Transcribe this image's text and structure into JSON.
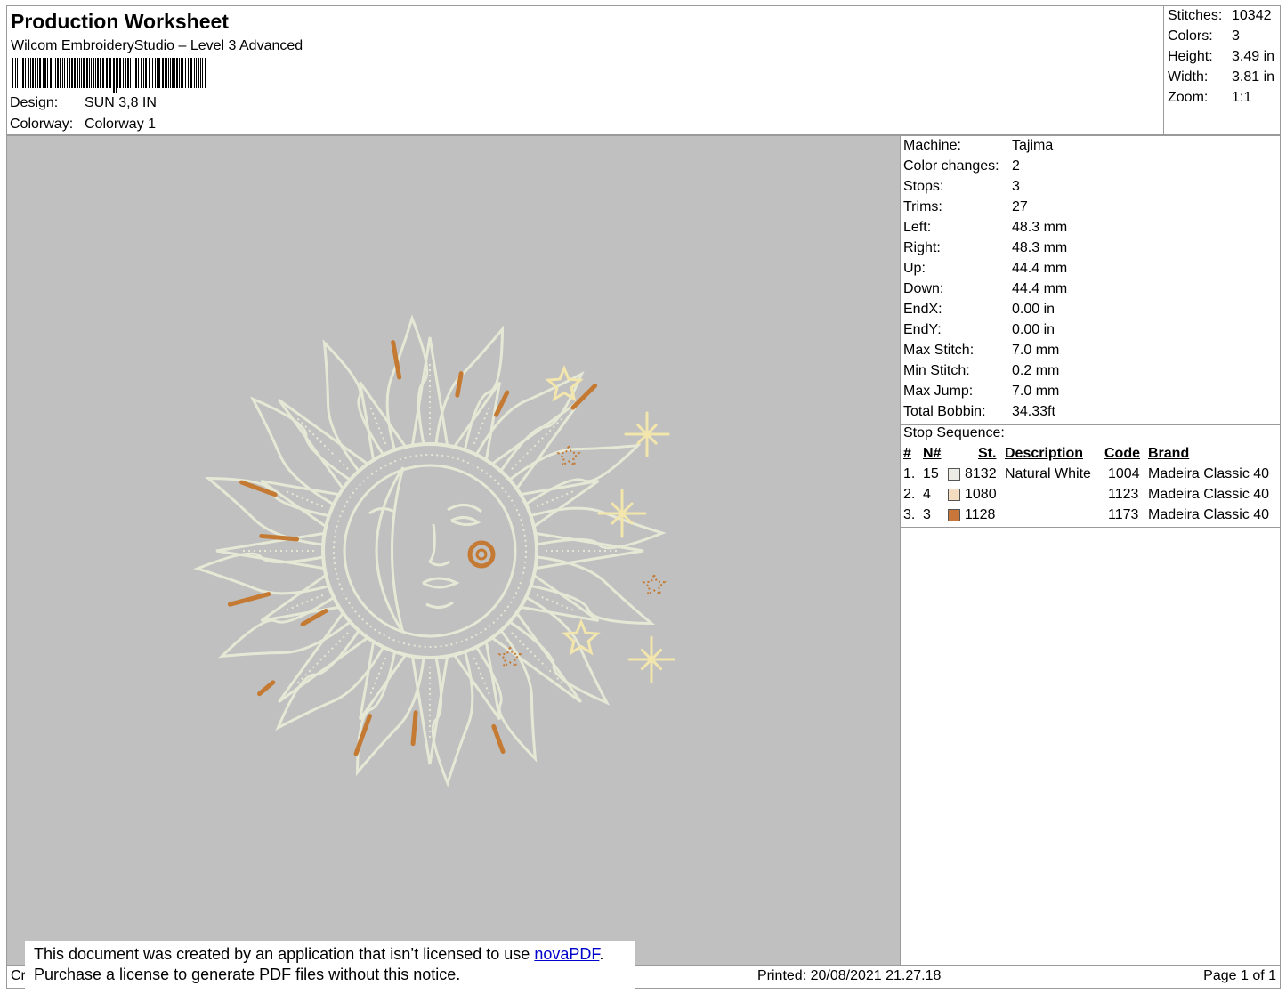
{
  "header": {
    "title": "Production Worksheet",
    "subtitle": "Wilcom EmbroideryStudio – Level 3 Advanced",
    "design_label": "Design:",
    "design_value": "SUN 3,8 IN",
    "colorway_label": "Colorway:",
    "colorway_value": "Colorway 1"
  },
  "summary": [
    {
      "label": "Stitches:",
      "value": "10342"
    },
    {
      "label": "Colors:",
      "value": "3"
    },
    {
      "label": "Height:",
      "value": "3.49 in"
    },
    {
      "label": "Width:",
      "value": "3.81 in"
    },
    {
      "label": "Zoom:",
      "value": "1:1"
    }
  ],
  "properties": [
    {
      "label": "Machine:",
      "value": "Tajima"
    },
    {
      "label": "Color changes:",
      "value": "2"
    },
    {
      "label": "Stops:",
      "value": "3"
    },
    {
      "label": "Trims:",
      "value": "27"
    },
    {
      "label": "Left:",
      "value": "48.3 mm"
    },
    {
      "label": "Right:",
      "value": "48.3 mm"
    },
    {
      "label": "Up:",
      "value": "44.4 mm"
    },
    {
      "label": "Down:",
      "value": "44.4 mm"
    },
    {
      "label": "EndX:",
      "value": "0.00 in"
    },
    {
      "label": "EndY:",
      "value": "0.00 in"
    },
    {
      "label": "Max Stitch:",
      "value": "7.0 mm"
    },
    {
      "label": "Min Stitch:",
      "value": "0.2 mm"
    },
    {
      "label": "Max Jump:",
      "value": "7.0 mm"
    },
    {
      "label": "Total Bobbin:",
      "value": "34.33ft"
    }
  ],
  "stop_sequence": {
    "label": "Stop Sequence:",
    "columns": [
      "#",
      "N#",
      "St.",
      "Description",
      "Code",
      "Brand"
    ],
    "rows": [
      {
        "index": "1.",
        "n": "15",
        "swatch": "#ecebe6",
        "st": "8132",
        "description": "Natural White",
        "code": "1004",
        "brand": "Madeira Classic 40"
      },
      {
        "index": "2.",
        "n": "4",
        "swatch": "#f3dcc0",
        "st": "1080",
        "description": "",
        "code": "1123",
        "brand": "Madeira Classic 40"
      },
      {
        "index": "3.",
        "n": "3",
        "swatch": "#c8763a",
        "st": "1128",
        "description": "",
        "code": "1173",
        "brand": "Madeira Classic 40"
      }
    ]
  },
  "footer": {
    "left_text": "Cr",
    "printed": "Printed: 20/08/2021 21.27.18",
    "page": "Page 1 of 1"
  },
  "notice": {
    "line1_prefix": "This document was created by an application that isn’t licensed to use ",
    "link": "novaPDF",
    "line1_suffix": ".",
    "line2": "Purchase a license to generate PDF files without this notice."
  },
  "colors": {
    "canvas": "#c0c0c0",
    "thread_white": "#e6e8d6",
    "thread_cream": "#f2e6ad",
    "thread_orange": "#c47a32"
  },
  "icons": [
    "barcode-icon",
    "sun-moon-embroidery-design"
  ]
}
